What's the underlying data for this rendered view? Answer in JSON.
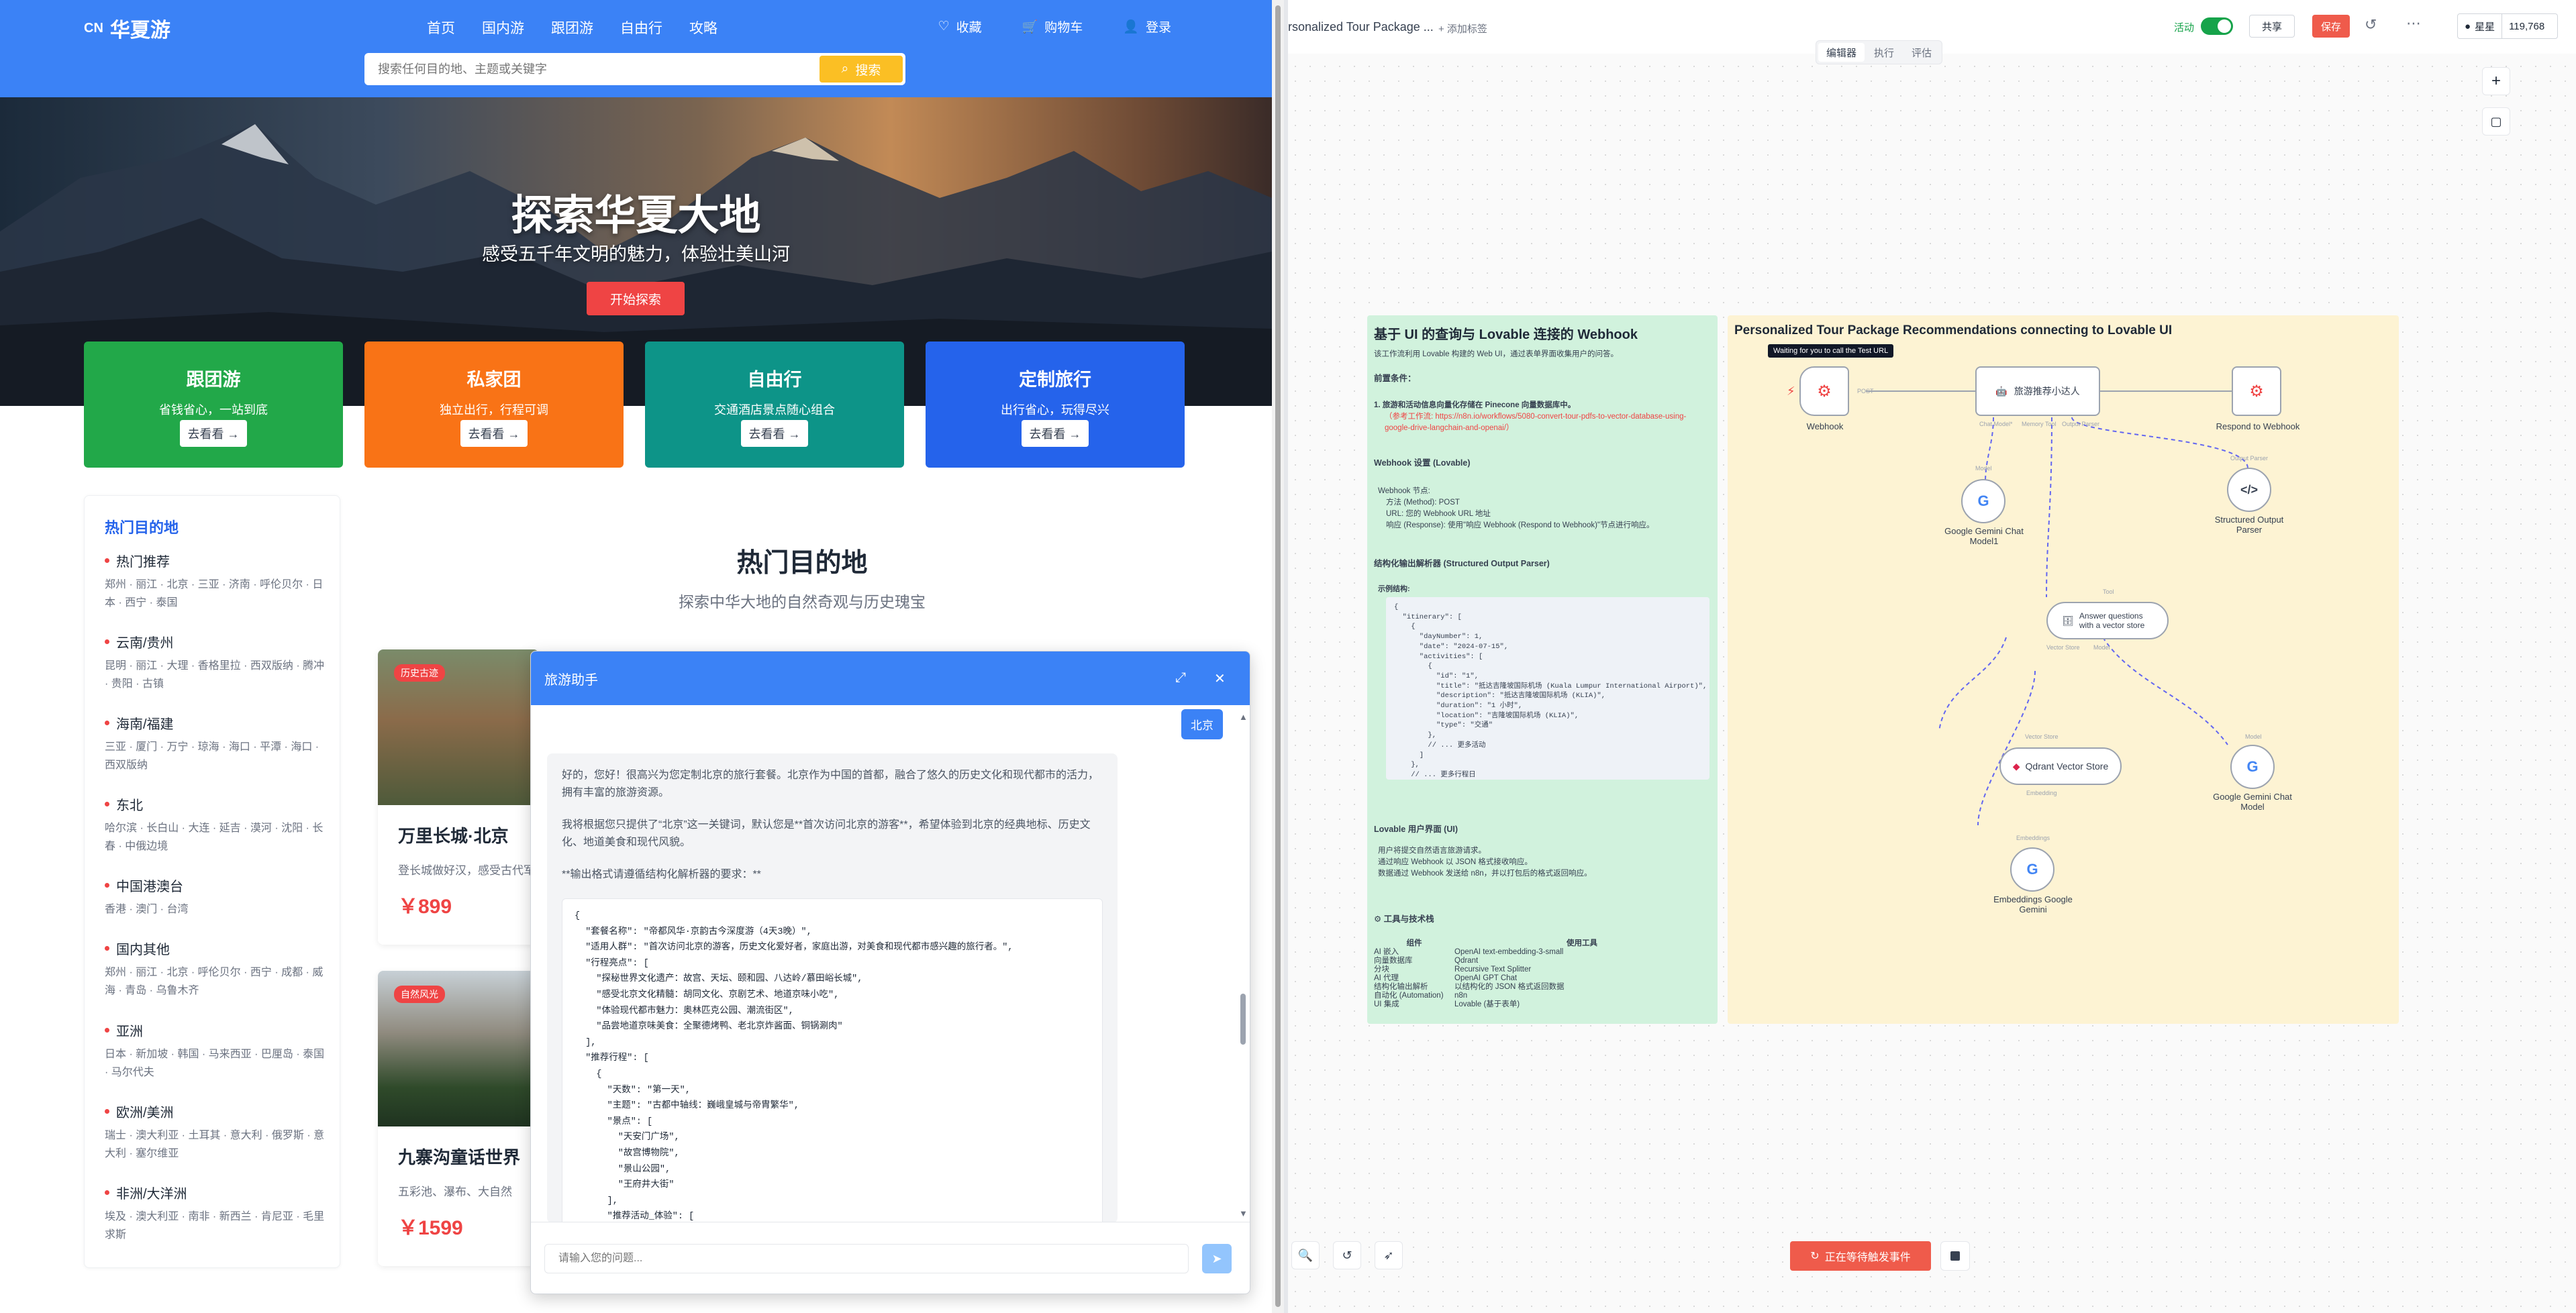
{
  "site": {
    "logo_prefix": "CN",
    "logo_name": "华夏游",
    "nav": [
      "首页",
      "国内游",
      "跟团游",
      "自由行",
      "攻略"
    ],
    "right_nav": {
      "favorites": "收藏",
      "cart": "购物车",
      "login": "登录"
    },
    "search_placeholder": "搜索任何目的地、主题或关键字",
    "search_button": "搜索"
  },
  "hero": {
    "title": "探索华夏大地",
    "subtitle": "感受五千年文明的魅力，体验壮美山河",
    "button": "开始探索"
  },
  "categories": [
    {
      "title": "跟团游",
      "desc": "省钱省心，一站到底",
      "button": "去看看 →",
      "color": "#22a849"
    },
    {
      "title": "私家团",
      "desc": "独立出行，行程可调",
      "button": "去看看 →",
      "color": "#f97316"
    },
    {
      "title": "自由行",
      "desc": "交通酒店景点随心组合",
      "button": "去看看 →",
      "color": "#0d9488"
    },
    {
      "title": "定制旅行",
      "desc": "出行省心，玩得尽兴",
      "button": "去看看 →",
      "color": "#2563eb"
    }
  ],
  "destinations": {
    "title": "热门目的地",
    "groups": [
      {
        "name": "热门推荐",
        "items": "郑州 · 丽江 · 北京 · 三亚 · 济南 · 呼伦贝尔 · 日本 · 西宁 · 泰国"
      },
      {
        "name": "云南/贵州",
        "items": "昆明 · 丽江 · 大理 · 香格里拉 · 西双版纳 · 腾冲 · 贵阳 · 古镇"
      },
      {
        "name": "海南/福建",
        "items": "三亚 · 厦门 · 万宁 · 琼海 · 海口 · 平潭 · 海口 · 西双版纳"
      },
      {
        "name": "东北",
        "items": "哈尔滨 · 长白山 · 大连 · 延吉 · 漠河 · 沈阳 · 长春 · 中俄边境"
      },
      {
        "name": "中国港澳台",
        "items": "香港 · 澳门 · 台湾"
      },
      {
        "name": "国内其他",
        "items": "郑州 · 丽江 · 北京 · 呼伦贝尔 · 西宁 · 成都 · 威海 · 青岛 · 乌鲁木齐"
      },
      {
        "name": "亚洲",
        "items": "日本 · 新加坡 · 韩国 · 马来西亚 · 巴厘岛 · 泰国 · 马尔代夫"
      },
      {
        "name": "欧洲/美洲",
        "items": "瑞士 · 澳大利亚 · 土耳其 · 意大利 · 俄罗斯 · 意大利 · 塞尔维亚"
      },
      {
        "name": "非洲/大洋洲",
        "items": "埃及 · 澳大利亚 · 南非 · 新西兰 · 肯尼亚 · 毛里求斯"
      }
    ]
  },
  "section": {
    "title": "热门目的地",
    "subtitle": "探索中华大地的自然奇观与历史瑰宝"
  },
  "dest_cards": [
    {
      "tag": "历史古迹",
      "name": "万里长城·北京",
      "desc": "登长城做好汉，感受古代军事壮观",
      "price": "￥899"
    },
    {
      "tag": "自然风光",
      "name": "九寨沟童话世界",
      "desc": "五彩池、瀑布、大自然",
      "price": "￥1599"
    }
  ],
  "chat": {
    "title": "旅游助手",
    "user_msg": "北京",
    "p1": "好的，您好！很高兴为您定制北京的旅行套餐。北京作为中国的首都，融合了悠久的历史文化和现代都市的活力，拥有丰富的旅游资源。",
    "p2": "我将根据您只提供了“北京”这一关键词，默认您是**首次访问北京的游客**，希望体验到北京的经典地标、历史文化、地道美食和现代风貌。",
    "p3": "**输出格式请遵循结构化解析器的要求：**",
    "code": "{\n  \"套餐名称\": \"帝都风华·京韵古今深度游（4天3晚）\",\n  \"适用人群\": \"首次访问北京的游客，历史文化爱好者，家庭出游，对美食和现代都市感兴趣的旅行者。\",\n  \"行程亮点\": [\n    \"探秘世界文化遗产：故宫、天坛、颐和园、八达岭/慕田峪长城\",\n    \"感受北京文化精髓：胡同文化、京剧艺术、地道京味小吃\",\n    \"体验现代都市魅力：奥林匹克公园、潮流街区\",\n    \"品尝地道京味美食：全聚德烤鸭、老北京炸酱面、铜锅涮肉\"\n  ],\n  \"推荐行程\": [\n    {\n      \"天数\": \"第一天\",\n      \"主题\": \"古都中轴线：巍峨皇城与帝胄繁华\",\n      \"景点\": [\n        \"天安门广场\",\n        \"故宫博物院\",\n        \"景山公园\",\n        \"王府井大街\"\n      ],\n      \"推荐活动_体验\": [\n        \"观看升旗仪式（需早起）\",\n        \"故宫深度讲解（可聘请导游或租用语音导览）\",\n        \"景山公园俯瞰故宫全景（最佳拍照点）\",\n        \"王府井小吃街品尝特色小吃（需注意卫生和价格）\"\n      ],\n      \"餐饮建议\": \"午餐：故宫周边简餐；晚餐：王府井特色餐厅，如四季民福烤鸭店或东来顺涮肉。\",\n    },",
    "input_placeholder": "请输入您的问题..."
  },
  "editor": {
    "workflow_title": "rsonalized Tour Package ...",
    "add_tag": "+ 添加标签",
    "active_label": "活动",
    "share": "共享",
    "save": "保存",
    "star_label": "星星",
    "star_count": "119,768",
    "tabs": [
      "编辑器",
      "执行",
      "评估"
    ],
    "waiting_button": "正在等待触发事件"
  },
  "note1": {
    "title": "基于 UI 的查询与 Lovable 连接的 Webhook",
    "intro": "该工作流利用 Lovable 构建的 Web UI，通过表单界面收集用户的问答。",
    "prereq_h": "前置条件：",
    "prereq": "1. 旅游和活动信息向量化存储在 Pinecone 向量数据库中。",
    "ref": "（参考工作流: https://n8n.io/workflows/5080-convert-tour-pdfs-to-vector-database-using-google-drive-langchain-and-openai/）",
    "webhook_h": "Webhook 设置 (Lovable)",
    "webhook_items": [
      "Webhook 节点:",
      "方法 (Method): POST",
      "URL: 您的 Webhook URL 地址",
      "响应 (Response): 使用\"响应 Webhook (Respond to Webhook)\"节点进行响应。"
    ],
    "parser_h": "结构化输出解析器 (Structured Output Parser)",
    "example_h": "示例结构:",
    "example": "{\n  \"itinerary\": [\n    {\n      \"dayNumber\": 1,\n      \"date\": \"2024-07-15\",\n      \"activities\": [\n        {\n          \"id\": \"1\",\n          \"title\": \"抵达吉隆坡国际机场 (Kuala Lumpur International Airport)\",\n          \"description\": \"抵达吉隆坡国际机场 (KLIA)\",\n          \"duration\": \"1 小时\",\n          \"location\": \"吉隆坡国际机场 (KLIA)\",\n          \"type\": \"交通\"\n        },\n        // ... 更多活动\n      ]\n    },\n    // ... 更多行程日\n  ]\n}",
    "ui_h": "Lovable 用户界面 (UI)",
    "ui_items": [
      "用户将提交自然语言旅游请求。",
      "通过响应 Webhook 以 JSON 格式接收响应。",
      "数据通过 Webhook 发送给 n8n，并以打包后的格式返回响应。"
    ],
    "tools_h": "⚙ 工具与技术栈",
    "tools_cols": [
      "组件",
      "使用工具"
    ],
    "tools": [
      [
        "AI 嵌入",
        "OpenAI text-embedding-3-small"
      ],
      [
        "向量数据库",
        "Qdrant"
      ],
      [
        "分块",
        "Recursive Text Splitter"
      ],
      [
        "AI 代理",
        "OpenAI GPT Chat"
      ],
      [
        "结构化输出解析",
        "以结构化的 JSON 格式返回数据"
      ],
      [
        "自动化 (Automation)",
        "n8n"
      ],
      [
        "UI 集成",
        "Lovable (基于表单)"
      ]
    ]
  },
  "note2": {
    "title": "Personalized Tour Package Recommendations connecting to Lovable UI",
    "tooltip": "Waiting for you to call the Test URL",
    "nodes": {
      "webhook": "Webhook",
      "agent": "旅游推荐小达人",
      "respond": "Respond to Webhook",
      "gemini1": "Google Gemini Chat Model1",
      "parser": "Structured Output Parser",
      "answer": "Answer questions with a vector store",
      "qdrant": "Qdrant Vector Store",
      "gemini2": "Google Gemini Chat Model",
      "embed": "Embeddings Google Gemini"
    },
    "ports": {
      "post": "POST",
      "chat_model": "Chat Model*",
      "memory": "Memory",
      "tool": "Tool",
      "output_parser": "Output Parser",
      "model": "Model",
      "vector_store": "Vector Store",
      "embedding": "Embedding",
      "embeddings": "Embeddings"
    }
  }
}
